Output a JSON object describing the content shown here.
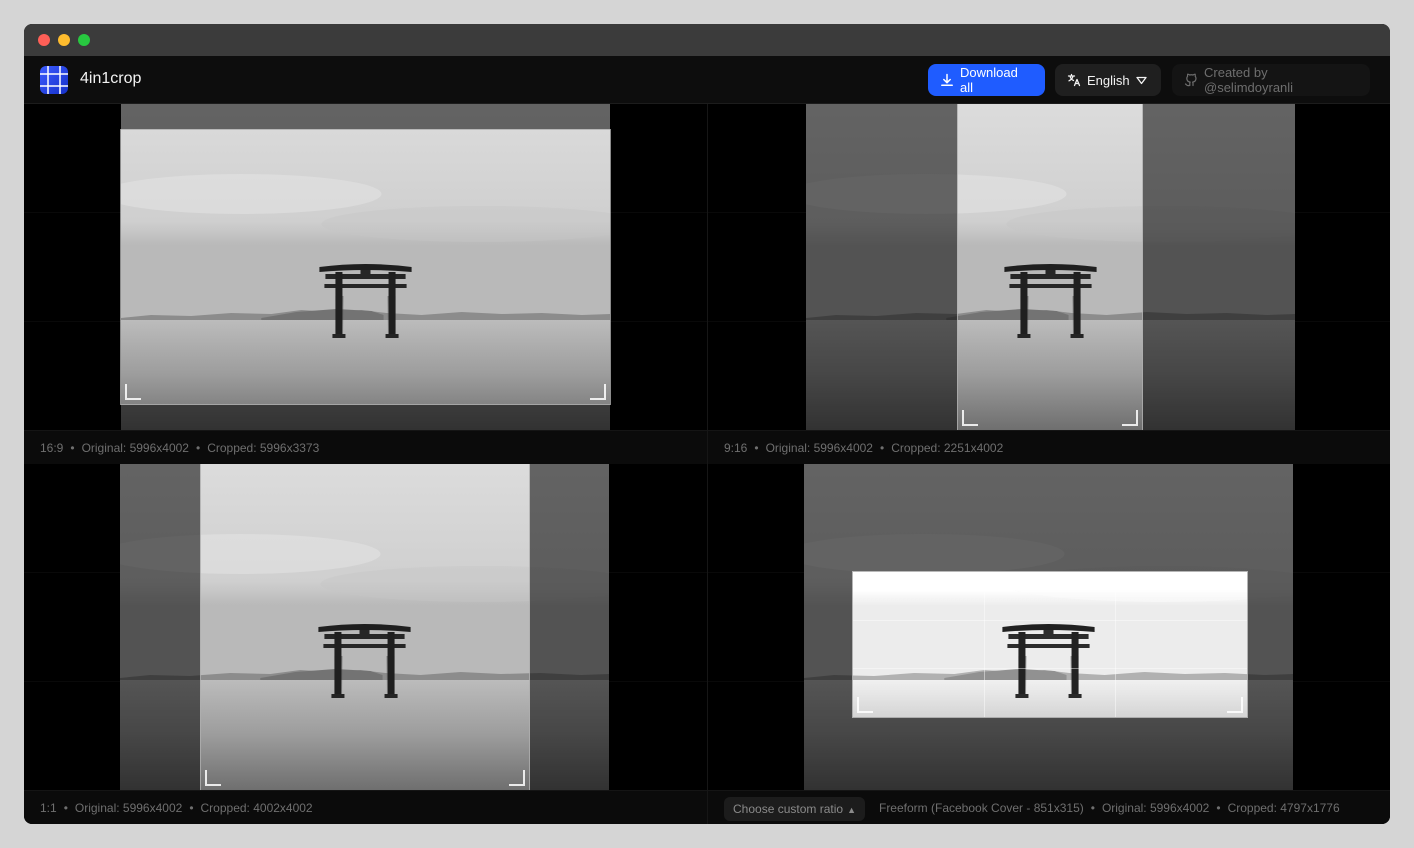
{
  "app": {
    "name": "4in1crop"
  },
  "toolbar": {
    "download_label": "Download all",
    "language_label": "English",
    "credit_label": "Created by @selimdoyranli"
  },
  "panels": [
    {
      "ratio": "16:9",
      "original": "Original: 5996x4002",
      "cropped": "Cropped: 5996x3373"
    },
    {
      "ratio": "9:16",
      "original": "Original: 5996x4002",
      "cropped": "Cropped: 2251x4002"
    },
    {
      "ratio": "1:1",
      "original": "Original: 5996x4002",
      "cropped": "Cropped: 4002x4002"
    },
    {
      "ratio": "Freeform (Facebook Cover - 851x315)",
      "original": "Original: 5996x4002",
      "cropped": "Cropped: 4797x1776",
      "custom_ratio_label": "Choose custom ratio"
    }
  ],
  "icons": {
    "download": "download-icon",
    "language": "translate-icon",
    "language_caret": "caret-down-icon",
    "credit": "github-icon",
    "custom_ratio_caret": "chevron-up-icon"
  },
  "colors": {
    "accent": "#1f5cff",
    "window_bg": "#0a0a0a",
    "titlebar": "#3b3b3b"
  }
}
